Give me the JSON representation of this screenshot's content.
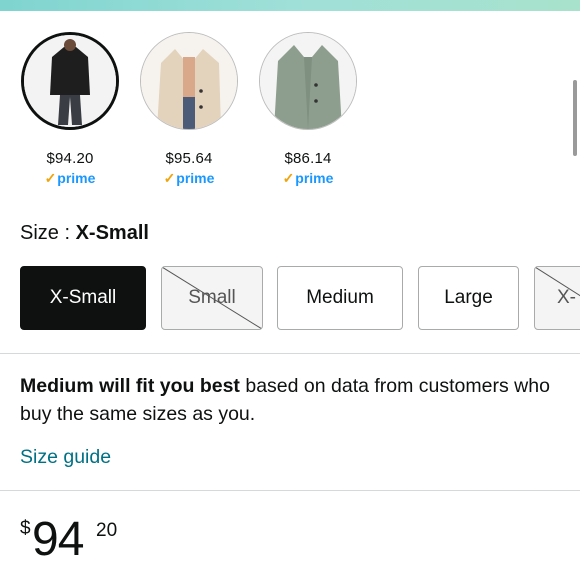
{
  "colors": {
    "accent_link": "#007185",
    "prime_blue": "#1a98ff",
    "prime_check": "#f0a30a",
    "selected_bg": "#0f1111"
  },
  "swatches": [
    {
      "price": "$94.20",
      "prime": "prime",
      "selected": true
    },
    {
      "price": "$95.64",
      "prime": "prime",
      "selected": false
    },
    {
      "price": "$86.14",
      "prime": "prime",
      "selected": false
    }
  ],
  "size": {
    "label_prefix": "Size : ",
    "selected_value": "X-Small",
    "options": [
      {
        "label": "X-Small",
        "state": "selected"
      },
      {
        "label": "Small",
        "state": "unavailable"
      },
      {
        "label": "Medium",
        "state": "available"
      },
      {
        "label": "Large",
        "state": "available"
      },
      {
        "label": "X-",
        "state": "unavailable"
      }
    ]
  },
  "fit": {
    "bold": "Medium will fit you best",
    "rest": " based on data from customers who buy the same sizes as you."
  },
  "size_guide": "Size guide",
  "price": {
    "currency": "$",
    "whole": "94",
    "fraction": "20"
  }
}
